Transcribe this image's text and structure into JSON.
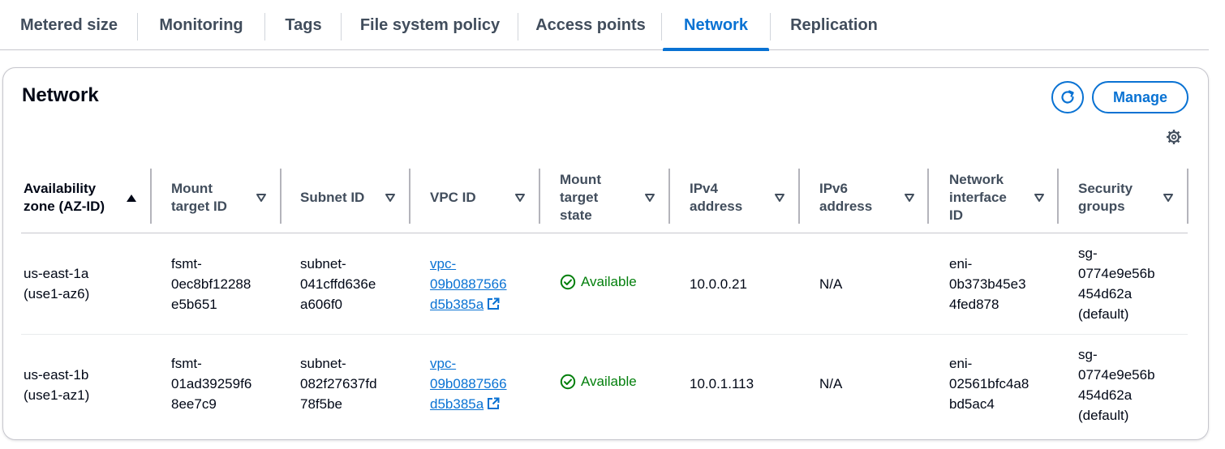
{
  "tabs": [
    {
      "label": "Metered size"
    },
    {
      "label": "Monitoring"
    },
    {
      "label": "Tags"
    },
    {
      "label": "File system policy"
    },
    {
      "label": "Access points"
    },
    {
      "label": "Network"
    },
    {
      "label": "Replication"
    }
  ],
  "active_tab": "Network",
  "panel": {
    "title": "Network",
    "refresh_icon": "refresh-icon",
    "manage_label": "Manage",
    "settings_icon": "gear-icon"
  },
  "table": {
    "headers": {
      "az": [
        "Availability",
        "zone (AZ-ID)"
      ],
      "mount_target_id": [
        "Mount",
        "target ID"
      ],
      "subnet_id": [
        "Subnet ID"
      ],
      "vpc_id": [
        "VPC ID"
      ],
      "mount_target_state": [
        "Mount",
        "target",
        "state"
      ],
      "ipv4": [
        "IPv4",
        "address"
      ],
      "ipv6": [
        "IPv6",
        "address"
      ],
      "network_interface_id": [
        "Network",
        "interface",
        "ID"
      ],
      "security_groups": [
        "Security",
        "groups"
      ]
    },
    "rows": [
      {
        "az": [
          "us-east-1a",
          "(use1-az6)"
        ],
        "mount_target_id": [
          "fsmt-",
          "0ec8bf12288",
          "e5b651"
        ],
        "subnet_id": [
          "subnet-",
          "041cffd636e",
          "a606f0"
        ],
        "vpc_id": [
          "vpc-",
          "09b0887566",
          "d5b385a"
        ],
        "state": "Available",
        "ipv4": "10.0.0.21",
        "ipv6": "N/A",
        "network_interface_id": [
          "eni-",
          "0b373b45e3",
          "4fed878"
        ],
        "security_groups": [
          "sg-",
          "0774e9e56b",
          "454d62a",
          "(default)"
        ]
      },
      {
        "az": [
          "us-east-1b",
          "(use1-az1)"
        ],
        "mount_target_id": [
          "fsmt-",
          "01ad39259f6",
          "8ee7c9"
        ],
        "subnet_id": [
          "subnet-",
          "082f27637fd",
          "78f5be"
        ],
        "vpc_id": [
          "vpc-",
          "09b0887566",
          "d5b385a"
        ],
        "state": "Available",
        "ipv4": "10.0.1.113",
        "ipv6": "N/A",
        "network_interface_id": [
          "eni-",
          "02561bfc4a8",
          "bd5ac4"
        ],
        "security_groups": [
          "sg-",
          "0774e9e56b",
          "454d62a",
          "(default)"
        ]
      }
    ]
  },
  "colors": {
    "accent": "#0972d3",
    "success": "#037f0c",
    "text": "#000716",
    "muted_text": "#414d5c"
  }
}
